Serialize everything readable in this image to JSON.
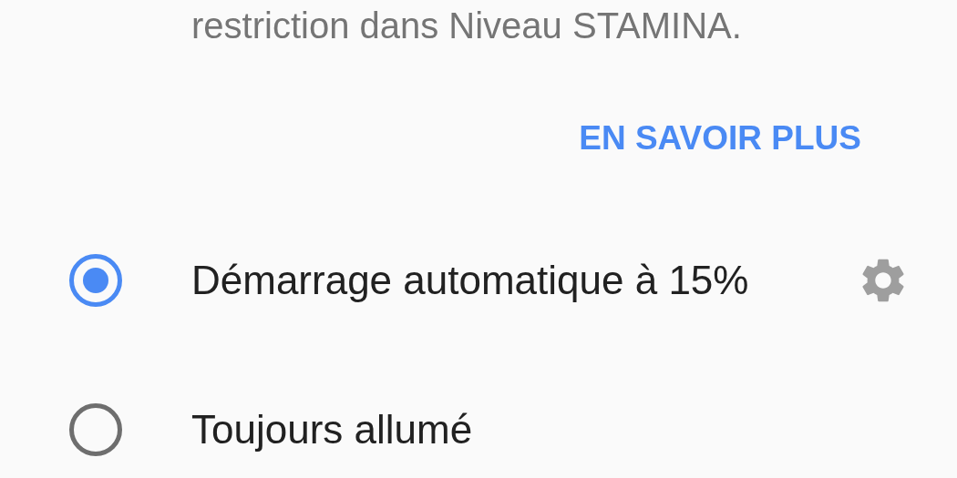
{
  "description": "restriction dans Niveau STAMINA.",
  "learn_more": "EN SAVOIR PLUS",
  "options": [
    {
      "label": "Démarrage automatique à 15%",
      "selected": true,
      "has_settings": true
    },
    {
      "label": "Toujours allumé",
      "selected": false,
      "has_settings": false
    }
  ]
}
